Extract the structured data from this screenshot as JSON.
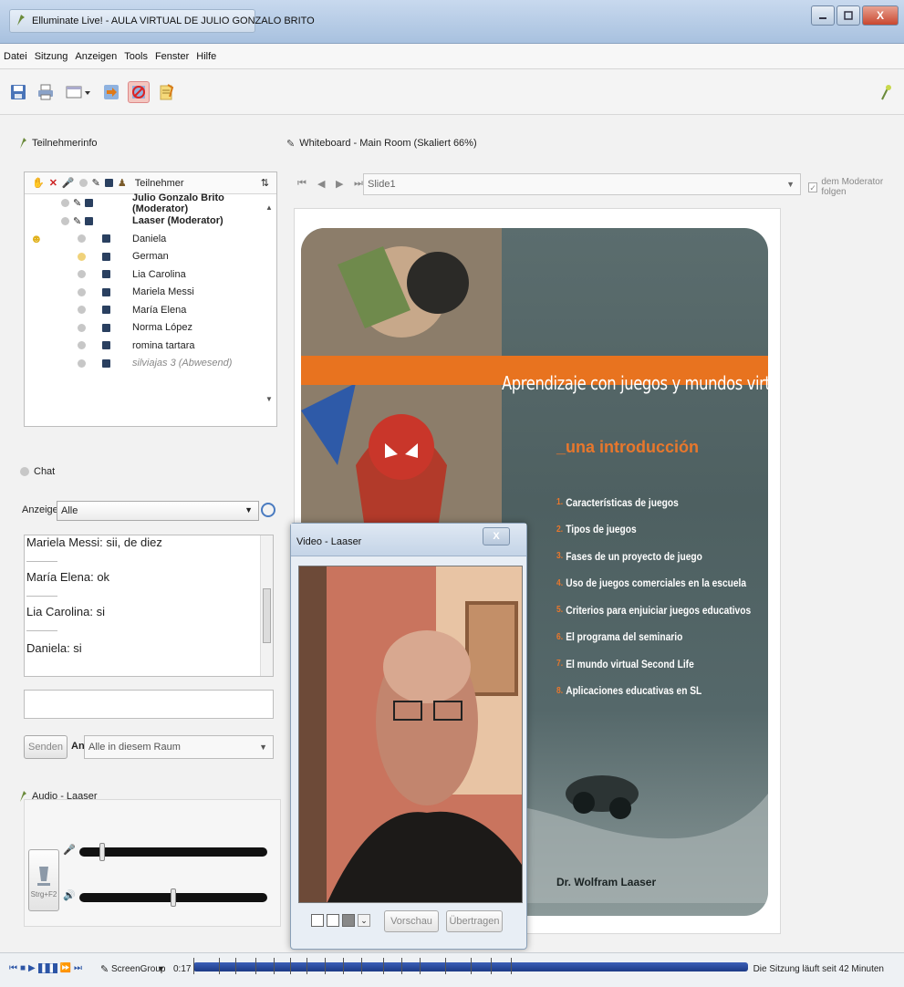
{
  "window": {
    "title": "Elluminate Live! - AULA VIRTUAL DE JULIO GONZALO BRITO",
    "close_label": "X"
  },
  "menu": [
    "Datei",
    "Sitzung",
    "Anzeigen",
    "Tools",
    "Fenster",
    "Hilfe"
  ],
  "participants_panel": {
    "header": "Teilnehmerinfo",
    "column_label": "Teilnehmer",
    "rows": [
      {
        "name": "Julio Gonzalo Brito (Moderator)",
        "style": "bold"
      },
      {
        "name": "Laaser (Moderator)",
        "style": "bold"
      },
      {
        "name": "Daniela",
        "style": "normal"
      },
      {
        "name": "German",
        "style": "normal"
      },
      {
        "name": "Lia Carolina",
        "style": "normal"
      },
      {
        "name": "Mariela Messi",
        "style": "normal"
      },
      {
        "name": "María Elena",
        "style": "normal"
      },
      {
        "name": "Norma López",
        "style": "normal"
      },
      {
        "name": "romina tartara",
        "style": "normal"
      },
      {
        "name": "silviajas 3 (Abwesend)",
        "style": "away"
      }
    ]
  },
  "chat": {
    "header": "Chat",
    "show_label": "Anzeigen",
    "show_value": "Alle",
    "messages": [
      "Mariela Messi: sii, de diez",
      "María Elena: ok",
      "Lia Carolina: si",
      "Daniela: si"
    ],
    "send_label": "Senden",
    "to_label": "An",
    "to_value": "Alle in diesem Raum"
  },
  "audio": {
    "header": "Audio - Laaser",
    "talk_shortcut": "Strg+F2",
    "mic_level": 0.12,
    "speaker_level": 0.5
  },
  "whiteboard": {
    "header": "Whiteboard - Main Room (Skaliert 66%)",
    "slide_value": "Slide1",
    "follow_label": "dem Moderator folgen",
    "slide": {
      "title": "Aprendizaje con juegos y mundos virtuales",
      "subtitle": "_una introducción",
      "items": [
        "Características de juegos",
        "Tipos de juegos",
        "Fases de un proyecto de juego",
        "Uso de juegos comerciales en la escuela",
        "Criterios para enjuiciar juegos educativos",
        "El programa del seminario",
        "El mundo virtual Second Life",
        "Aplicaciones educativas en SL"
      ],
      "author": "Dr. Wolfram Laaser"
    }
  },
  "video": {
    "title": "Video - Laaser",
    "close_label": "X",
    "preview_label": "Vorschau",
    "transmit_label": "Übertragen"
  },
  "status": {
    "screen_group": "ScreenGroup",
    "time": "0:17",
    "session_text": "Die Sitzung läuft seit 42 Minuten"
  }
}
